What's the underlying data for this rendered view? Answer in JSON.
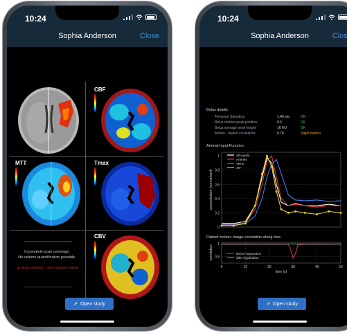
{
  "status": {
    "time": "10:24"
  },
  "header": {
    "title": "Sophia Anderson",
    "close_label": "Close"
  },
  "left": {
    "maps": [
      {
        "label": "",
        "type": "ct"
      },
      {
        "label": "CBF",
        "unit": "ml/100g/min",
        "type": "perfusion"
      },
      {
        "label": "MTT",
        "unit": "s",
        "type": "perfusion"
      },
      {
        "label": "Tmax",
        "unit": "s",
        "type": "perfusion"
      },
      {
        "label": "CBV",
        "unit": "ml/100g",
        "type": "perfusion"
      }
    ],
    "note_line1": "Incomplete scan coverage.",
    "note_line2": "No volume quantification possible.",
    "warning": "Motion detected - check analyzed volume",
    "open_button": "Open study"
  },
  "right": {
    "bolus": {
      "title": "Bolus details",
      "rows": [
        {
          "label": "Temporal Sampling:",
          "value": "1.48 sec",
          "status": "OK",
          "status_color": "#2ecc40"
        },
        {
          "label": "Bolus relative peak position:",
          "value": "0.5",
          "status": "OK",
          "status_color": "#2ecc40"
        },
        {
          "label": "Bolus average peak height:",
          "value": "16 HU",
          "status": "OK",
          "status_color": "#2ecc40"
        },
        {
          "label": "Motion - lowest correlation:",
          "value": "0.78",
          "status": "Slight motion",
          "status_color": "#f0a020"
        }
      ]
    },
    "aif_title": "Arterial Input Function",
    "motion_title": "Patient motion: image correlation along time",
    "open_button": "Open study"
  },
  "chart_data": [
    {
      "type": "line",
      "title": "Arterial Input Function",
      "ylabel": "concentration (normalised)",
      "xlabel": "",
      "ylim": [
        0,
        1.05
      ],
      "yticks": [
        0,
        0.2,
        0.4,
        0.6,
        0.8,
        1
      ],
      "xlim": [
        0,
        50
      ],
      "grid": true,
      "legend": "top-left",
      "series": [
        {
          "name": "All voxels",
          "color": "#ffffff",
          "x": [
            0,
            5,
            10,
            14,
            17,
            19,
            21,
            23,
            25,
            28,
            31,
            35,
            40,
            45,
            50
          ],
          "y": [
            0.05,
            0.05,
            0.08,
            0.3,
            0.7,
            0.97,
            0.9,
            0.6,
            0.35,
            0.3,
            0.33,
            0.3,
            0.3,
            0.32,
            0.3
          ]
        },
        {
          "name": "Arteries",
          "color": "#e03030",
          "x": [
            0,
            5,
            10,
            14,
            17,
            19,
            21,
            23,
            25,
            28,
            31,
            35,
            40,
            45,
            50
          ],
          "y": [
            0.04,
            0.04,
            0.06,
            0.25,
            0.6,
            0.92,
            1.0,
            0.7,
            0.4,
            0.3,
            0.32,
            0.3,
            0.28,
            0.3,
            0.3
          ]
        },
        {
          "name": "Veins",
          "color": "#3a7ee8",
          "x": [
            0,
            5,
            10,
            14,
            17,
            19,
            21,
            23,
            25,
            28,
            31,
            35,
            40,
            45,
            50
          ],
          "y": [
            0.03,
            0.03,
            0.05,
            0.15,
            0.4,
            0.7,
            0.88,
            0.95,
            0.75,
            0.45,
            0.38,
            0.37,
            0.38,
            0.36,
            0.37
          ]
        },
        {
          "name": "AIF",
          "color": "#e8d020",
          "x": [
            0,
            5,
            10,
            14,
            17,
            19,
            21,
            23,
            25,
            28,
            31,
            35,
            40,
            45,
            50
          ],
          "y": [
            0.02,
            0.02,
            0.05,
            0.3,
            0.75,
            1.0,
            0.85,
            0.5,
            0.25,
            0.2,
            0.22,
            0.2,
            0.18,
            0.22,
            0.2
          ]
        }
      ]
    },
    {
      "type": "line",
      "title": "Patient motion: image correlation along time",
      "ylabel": "correlation",
      "xlabel": "time (s)",
      "xlim": [
        0,
        50
      ],
      "xticks": [
        0,
        10,
        20,
        30,
        40,
        50
      ],
      "ylim": [
        0.7,
        1.02
      ],
      "yticks": [
        1,
        0.8
      ],
      "grid": true,
      "legend": "bottom-left",
      "series": [
        {
          "name": "before registration",
          "color": "#e03030",
          "x": [
            0,
            10,
            20,
            25,
            28,
            29,
            30,
            31,
            32,
            35,
            40,
            45,
            50
          ],
          "y": [
            0.99,
            0.99,
            0.99,
            0.99,
            0.99,
            0.9,
            0.78,
            0.85,
            0.98,
            0.99,
            0.99,
            0.99,
            0.99
          ]
        },
        {
          "name": "after registration",
          "color": "#20b0a0",
          "x": [
            0,
            10,
            20,
            30,
            40,
            50
          ],
          "y": [
            0.995,
            0.995,
            0.995,
            0.995,
            0.995,
            0.995
          ]
        }
      ]
    }
  ]
}
